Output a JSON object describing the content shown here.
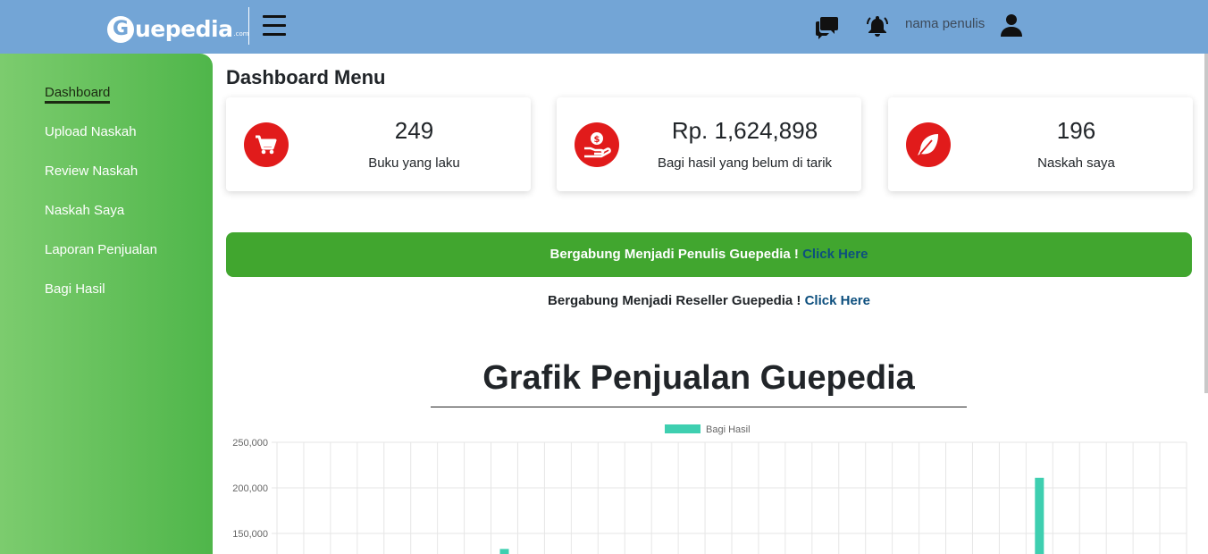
{
  "header": {
    "logo_letter": "G",
    "logo_text": "uepedia",
    "logo_suffix": ".com",
    "user_name": "nama penulis",
    "icons": [
      "hamburger-menu-icon",
      "chat-icon",
      "bell-icon",
      "user-icon"
    ],
    "bg_color": "#73a5d6"
  },
  "sidebar": {
    "items": [
      {
        "label": "Dashboard",
        "active": true
      },
      {
        "label": "Upload Naskah"
      },
      {
        "label": "Review Naskah"
      },
      {
        "label": "Naskah Saya"
      },
      {
        "label": "Laporan Penjualan"
      },
      {
        "label": "Bagi Hasil"
      }
    ]
  },
  "main": {
    "title": "Dashboard Menu",
    "cards": [
      {
        "value": "249",
        "label": "Buku yang laku",
        "icon": "cart-icon"
      },
      {
        "value": "Rp. 1,624,898",
        "label": "Bagi hasil yang belum di tarik",
        "icon": "money-hand-icon"
      },
      {
        "value": "196",
        "label": "Naskah saya",
        "icon": "feather-icon"
      }
    ],
    "banner_text": "Bergabung Menjadi Penulis Guepedia ! ",
    "banner_link": "Click Here",
    "reseller_text": "Bergabung Menjadi Reseller Guepedia ! ",
    "reseller_link": "Click Here",
    "accent_red": "#e11b1b",
    "banner_green": "#41a62f"
  },
  "chart_data": {
    "type": "bar",
    "title": "Grafik Penjualan Guepedia",
    "series": [
      {
        "name": "Bagi Hasil",
        "color": "#3ecfb0",
        "points": [
          {
            "index": 8,
            "value": 133000
          },
          {
            "index": 28,
            "value": 211000
          }
        ]
      }
    ],
    "num_categories": 34,
    "yticks": [
      "250,000",
      "200,000",
      "150,000"
    ],
    "ylim": [
      0,
      250000
    ],
    "grid": true,
    "legend": "top-center"
  }
}
